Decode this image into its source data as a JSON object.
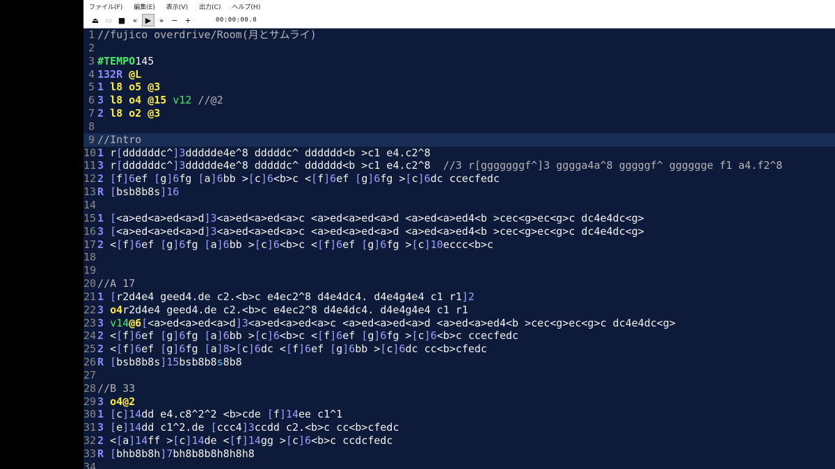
{
  "menu": [
    "ファイル(F)",
    "編集(E)",
    "表示(V)",
    "出力(C)",
    "ヘルプ(H)"
  ],
  "toolbar": {
    "time": "00:00:00.0",
    "buttons": [
      {
        "name": "open-icon",
        "glyph": "⏏"
      },
      {
        "name": "save-icon",
        "glyph": "▭",
        "disabled": true
      },
      {
        "name": "stop-icon",
        "glyph": "■"
      },
      {
        "name": "rewind-icon",
        "glyph": "«"
      },
      {
        "name": "play-icon",
        "glyph": "▶",
        "pressed": true
      },
      {
        "name": "fast-forward-icon",
        "glyph": "»"
      },
      {
        "name": "minus-icon",
        "glyph": "−"
      },
      {
        "name": "plus-icon",
        "glyph": "+"
      }
    ]
  },
  "lines": [
    {
      "n": "1",
      "t": [
        [
          "c",
          "//fujico overdrive/Room(月とサムライ)"
        ]
      ]
    },
    {
      "n": "2",
      "t": []
    },
    {
      "n": "3",
      "t": [
        [
          "d",
          "#TEMPO"
        ],
        [
          "",
          "145"
        ]
      ]
    },
    {
      "n": "4",
      "t": [
        [
          "r",
          "132R "
        ],
        [
          "p",
          "@L"
        ]
      ]
    },
    {
      "n": "5",
      "t": [
        [
          "r",
          "1 "
        ],
        [
          "p",
          "l8 o5 @3"
        ]
      ]
    },
    {
      "n": "6",
      "t": [
        [
          "r",
          "3 "
        ],
        [
          "p",
          "l8 o4 @15 "
        ],
        [
          "v",
          "v12"
        ],
        [
          "c",
          " //@2"
        ]
      ]
    },
    {
      "n": "7",
      "t": [
        [
          "r",
          "2 "
        ],
        [
          "p",
          "l8 o2 @3"
        ]
      ]
    },
    {
      "n": "8",
      "t": []
    },
    {
      "n": "9",
      "t": [
        [
          "c",
          "//Intro"
        ]
      ],
      "current": true
    },
    {
      "n": "10",
      "t": [
        [
          "r",
          "1 "
        ],
        [
          "",
          "r"
        ],
        [
          "b",
          "["
        ],
        [
          "",
          "ddddddc^"
        ],
        [
          "b",
          "]3"
        ],
        [
          "",
          ""
        ],
        [
          "",
          "ddddde4e^8 dddddc^ dddddd<b >c1 e4.c2^8"
        ]
      ]
    },
    {
      "n": "11",
      "t": [
        [
          "r",
          "3 "
        ],
        [
          "",
          "r"
        ],
        [
          "b",
          "["
        ],
        [
          "",
          "ddddddc^"
        ],
        [
          "b",
          "]3"
        ],
        [
          "",
          ""
        ],
        [
          "",
          "ddddde4e^8 dddddc^ dddddd<b >c1 e4.c2^8  "
        ],
        [
          "c",
          "//3 r[gggggggf^]3 ggggа4a^8 gggggf^ gggggge f1 a4.f2^8"
        ]
      ]
    },
    {
      "n": "12",
      "t": [
        [
          "r",
          "2 "
        ],
        [
          "b",
          "["
        ],
        [
          "",
          "f"
        ],
        [
          "b",
          "]6"
        ],
        [
          "",
          "ef "
        ],
        [
          "b",
          "["
        ],
        [
          "",
          "g"
        ],
        [
          "b",
          "]6"
        ],
        [
          "",
          "fg "
        ],
        [
          "b",
          "["
        ],
        [
          "",
          "a"
        ],
        [
          "b",
          "]6"
        ],
        [
          "",
          "bb >"
        ],
        [
          "b",
          "["
        ],
        [
          "",
          "c"
        ],
        [
          "b",
          "]6"
        ],
        [
          "",
          "<b>c <"
        ],
        [
          "b",
          "["
        ],
        [
          "",
          "f"
        ],
        [
          "b",
          "]6"
        ],
        [
          "",
          "ef "
        ],
        [
          "b",
          "["
        ],
        [
          "",
          "g"
        ],
        [
          "b",
          "]6"
        ],
        [
          "",
          "fg >"
        ],
        [
          "b",
          "["
        ],
        [
          "",
          "c"
        ],
        [
          "b",
          "]6"
        ],
        [
          "",
          "dc ccecfedc"
        ]
      ]
    },
    {
      "n": "13",
      "t": [
        [
          "r",
          "R "
        ],
        [
          "b",
          "["
        ],
        [
          "",
          "bsb8b8s"
        ],
        [
          "b",
          "]16"
        ]
      ]
    },
    {
      "n": "14",
      "t": []
    },
    {
      "n": "15",
      "t": [
        [
          "r",
          "1 "
        ],
        [
          "b",
          "["
        ],
        [
          "",
          "<a>ed<a>ed<a>d"
        ],
        [
          "b",
          "]3"
        ],
        [
          "",
          ""
        ],
        [
          "",
          "<a>ed<a>ed<a>c <a>ed<a>ed<a>d <a>ed<a>ed4<b >cec<g>ec<g>c dc4e4dc<g>"
        ]
      ]
    },
    {
      "n": "16",
      "t": [
        [
          "r",
          "3 "
        ],
        [
          "b",
          "["
        ],
        [
          "",
          "<a>ed<a>ed<a>d"
        ],
        [
          "b",
          "]3"
        ],
        [
          "",
          ""
        ],
        [
          "",
          "<a>ed<a>ed<a>c <a>ed<a>ed<a>d <a>ed<a>ed4<b >cec<g>ec<g>c dc4e4dc<g>"
        ]
      ]
    },
    {
      "n": "17",
      "t": [
        [
          "r",
          "2 "
        ],
        [
          "",
          "<"
        ],
        [
          "b",
          "["
        ],
        [
          "",
          "f"
        ],
        [
          "b",
          "]6"
        ],
        [
          "",
          "ef "
        ],
        [
          "b",
          "["
        ],
        [
          "",
          "g"
        ],
        [
          "b",
          "]6"
        ],
        [
          "",
          "fg "
        ],
        [
          "b",
          "["
        ],
        [
          "",
          "a"
        ],
        [
          "b",
          "]6"
        ],
        [
          "",
          "bb >"
        ],
        [
          "b",
          "["
        ],
        [
          "",
          "c"
        ],
        [
          "b",
          "]6"
        ],
        [
          "",
          "<b>c <"
        ],
        [
          "b",
          "["
        ],
        [
          "",
          "f"
        ],
        [
          "b",
          "]6"
        ],
        [
          "",
          "ef "
        ],
        [
          "b",
          "["
        ],
        [
          "",
          "g"
        ],
        [
          "b",
          "]6"
        ],
        [
          "",
          "fg >"
        ],
        [
          "b",
          "["
        ],
        [
          "",
          "c"
        ],
        [
          "b",
          "]10"
        ],
        [
          "",
          "eccc<b>c"
        ]
      ]
    },
    {
      "n": "18",
      "t": []
    },
    {
      "n": "19",
      "t": []
    },
    {
      "n": "20",
      "t": [
        [
          "c",
          "//A 17"
        ]
      ]
    },
    {
      "n": "21",
      "t": [
        [
          "r",
          "1 "
        ],
        [
          "b",
          "["
        ],
        [
          "",
          "r2d4e4 geed4.de c2.<b>c e4ec2^8 d4e4dc4. d4e4g4e4 c1 r1"
        ],
        [
          "b",
          "]2"
        ]
      ]
    },
    {
      "n": "22",
      "t": [
        [
          "r",
          "3 "
        ],
        [
          "p",
          "o4"
        ],
        [
          "",
          "r2d4e4 geed4.de c2.<b>c e4ec2^8 d4e4dc4. d4e4g4e4 c1 r1"
        ]
      ]
    },
    {
      "n": "23",
      "t": [
        [
          "r",
          "3 "
        ],
        [
          "v",
          "v14"
        ],
        [
          "p",
          "@6"
        ],
        [
          "b",
          "["
        ],
        [
          "",
          "<a>ed<a>ed<a>d"
        ],
        [
          "b",
          "]3"
        ],
        [
          "",
          ""
        ],
        [
          "",
          "<a>ed<a>ed<a>c <a>ed<a>ed<a>d <a>ed<a>ed4<b >cec<g>ec<g>c dc4e4dc<g>"
        ]
      ]
    },
    {
      "n": "24",
      "t": [
        [
          "r",
          "2 "
        ],
        [
          "",
          "<"
        ],
        [
          "b",
          "["
        ],
        [
          "",
          "f"
        ],
        [
          "b",
          "]6"
        ],
        [
          "",
          "ef "
        ],
        [
          "b",
          "["
        ],
        [
          "",
          "g"
        ],
        [
          "b",
          "]6"
        ],
        [
          "",
          "fg "
        ],
        [
          "b",
          "["
        ],
        [
          "",
          "a"
        ],
        [
          "b",
          "]6"
        ],
        [
          "",
          "bb >"
        ],
        [
          "b",
          "["
        ],
        [
          "",
          "c"
        ],
        [
          "b",
          "]6"
        ],
        [
          "",
          "<b>c <"
        ],
        [
          "b",
          "["
        ],
        [
          "",
          "f"
        ],
        [
          "b",
          "]6"
        ],
        [
          "",
          "ef "
        ],
        [
          "b",
          "["
        ],
        [
          "",
          "g"
        ],
        [
          "b",
          "]6"
        ],
        [
          "",
          "fg >"
        ],
        [
          "b",
          "["
        ],
        [
          "",
          "c"
        ],
        [
          "b",
          "]6"
        ],
        [
          "",
          "<b>c ccecfedc"
        ]
      ]
    },
    {
      "n": "25",
      "t": [
        [
          "r",
          "2 "
        ],
        [
          "",
          "<"
        ],
        [
          "b",
          "["
        ],
        [
          "",
          "f"
        ],
        [
          "b",
          "]6"
        ],
        [
          "",
          "ef "
        ],
        [
          "b",
          "["
        ],
        [
          "",
          "g"
        ],
        [
          "b",
          "]6"
        ],
        [
          "",
          "fg "
        ],
        [
          "b",
          "["
        ],
        [
          "",
          "a"
        ],
        [
          "b",
          "]8"
        ],
        [
          "",
          ""
        ],
        [
          "",
          ">"
        ],
        [
          "b",
          "["
        ],
        [
          "",
          "c"
        ],
        [
          "b",
          "]6"
        ],
        [
          "",
          "dc <"
        ],
        [
          "b",
          "["
        ],
        [
          "",
          "f"
        ],
        [
          "b",
          "]6"
        ],
        [
          "",
          "ef "
        ],
        [
          "b",
          "["
        ],
        [
          "",
          "g"
        ],
        [
          "b",
          "]6"
        ],
        [
          "",
          "bb >"
        ],
        [
          "b",
          "["
        ],
        [
          "",
          "c"
        ],
        [
          "b",
          "]6"
        ],
        [
          "",
          "dc cc<b>cfedc"
        ]
      ]
    },
    {
      "n": "26",
      "t": [
        [
          "r",
          "R "
        ],
        [
          "b",
          "["
        ],
        [
          "",
          "bsb8b8s"
        ],
        [
          "b",
          "]15"
        ],
        [
          "",
          ""
        ],
        [
          "",
          "bsb8b8"
        ],
        [
          "h",
          "s"
        ],
        [
          "",
          "8b8"
        ]
      ]
    },
    {
      "n": "27",
      "t": []
    },
    {
      "n": "28",
      "t": [
        [
          "c",
          "//B 33"
        ]
      ]
    },
    {
      "n": "29",
      "t": [
        [
          "r",
          "3 "
        ],
        [
          "p",
          "o4@2"
        ]
      ]
    },
    {
      "n": "30",
      "t": [
        [
          "r",
          "1 "
        ],
        [
          "b",
          "["
        ],
        [
          "",
          "c"
        ],
        [
          "b",
          "]14"
        ],
        [
          "",
          ""
        ],
        [
          "",
          "dd e4.c8^2^2 <b>cde "
        ],
        [
          "b",
          "["
        ],
        [
          "",
          "f"
        ],
        [
          "b",
          "]14"
        ],
        [
          "",
          ""
        ],
        [
          "",
          "ee c1^1"
        ]
      ]
    },
    {
      "n": "31",
      "t": [
        [
          "r",
          "3 "
        ],
        [
          "b",
          "["
        ],
        [
          "",
          "e"
        ],
        [
          "b",
          "]14"
        ],
        [
          "",
          ""
        ],
        [
          "",
          "dd c1^2.de "
        ],
        [
          "b",
          "["
        ],
        [
          "",
          "ccc4"
        ],
        [
          "b",
          "]3"
        ],
        [
          "",
          ""
        ],
        [
          "",
          "ccdd c2.<b>c cc<b>cfedc"
        ]
      ]
    },
    {
      "n": "32",
      "t": [
        [
          "r",
          "2 "
        ],
        [
          "",
          "<"
        ],
        [
          "b",
          "["
        ],
        [
          "",
          "a"
        ],
        [
          "b",
          "]14"
        ],
        [
          "",
          "ff >"
        ],
        [
          "b",
          "["
        ],
        [
          "",
          "c"
        ],
        [
          "b",
          "]14"
        ],
        [
          "",
          "de <"
        ],
        [
          "b",
          "["
        ],
        [
          "",
          "f"
        ],
        [
          "b",
          "]14"
        ],
        [
          "",
          "gg >"
        ],
        [
          "b",
          "["
        ],
        [
          "",
          "c"
        ],
        [
          "b",
          "]6"
        ],
        [
          "",
          "<b>c ccdcfedc"
        ]
      ]
    },
    {
      "n": "33",
      "t": [
        [
          "r",
          "R "
        ],
        [
          "b",
          "["
        ],
        [
          "",
          "bhb8b8h"
        ],
        [
          "b",
          "]7"
        ],
        [
          "",
          ""
        ],
        [
          "",
          "bh8b8b8h8h8h8"
        ]
      ]
    },
    {
      "n": "34",
      "t": []
    }
  ]
}
